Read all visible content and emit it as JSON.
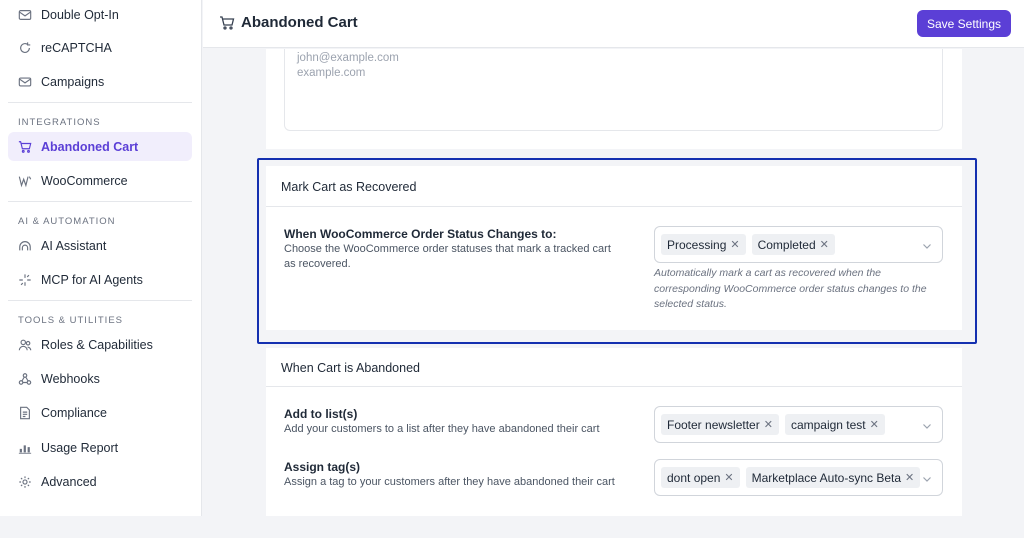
{
  "sidebar": {
    "items_top": [
      {
        "label": "Double Opt-In",
        "icon": "mail-check-icon"
      },
      {
        "label": "reCAPTCHA",
        "icon": "recaptcha-icon"
      },
      {
        "label": "Campaigns",
        "icon": "mail-icon"
      }
    ],
    "section_integrations": "INTEGRATIONS",
    "integrations": [
      {
        "label": "Abandoned Cart",
        "icon": "cart-icon",
        "active": true
      },
      {
        "label": "WooCommerce",
        "icon": "woocommerce-icon"
      }
    ],
    "section_ai": "AI & AUTOMATION",
    "ai": [
      {
        "label": "AI Assistant",
        "icon": "ai-icon"
      },
      {
        "label": "MCP for AI Agents",
        "icon": "sparkle-icon"
      }
    ],
    "section_tools": "TOOLS & UTILITIES",
    "tools": [
      {
        "label": "Roles & Capabilities",
        "icon": "users-icon"
      },
      {
        "label": "Webhooks",
        "icon": "webhook-icon"
      },
      {
        "label": "Compliance",
        "icon": "document-icon"
      },
      {
        "label": "Usage Report",
        "icon": "bar-chart-icon"
      },
      {
        "label": "Advanced",
        "icon": "gear-icon"
      }
    ]
  },
  "header": {
    "title": "Abandoned Cart",
    "save_label": "Save Settings"
  },
  "emails_textarea": {
    "lines": [
      "john@example.com",
      "example.com"
    ]
  },
  "mark_recovered": {
    "heading": "Mark Cart as Recovered",
    "title": "When WooCommerce Order Status Changes to:",
    "description": "Choose the WooCommerce order statuses that mark a tracked cart as recovered.",
    "statuses": [
      "Processing",
      "Completed"
    ],
    "hint": "Automatically mark a cart as recovered when the corresponding WooCommerce order status changes to the selected status."
  },
  "abandoned": {
    "heading": "When Cart is Abandoned",
    "lists_title": "Add to list(s)",
    "lists_description": "Add your customers to a list after they have abandoned their cart",
    "lists": [
      "Footer newsletter",
      "campaign test"
    ],
    "tags_title": "Assign tag(s)",
    "tags_description": "Assign a tag to your customers after they have abandoned their cart",
    "tags": [
      "dont open",
      "Marketplace Auto-sync Beta"
    ]
  },
  "colors": {
    "accent": "#5b3fd6",
    "highlight_border": "#1430b0"
  }
}
